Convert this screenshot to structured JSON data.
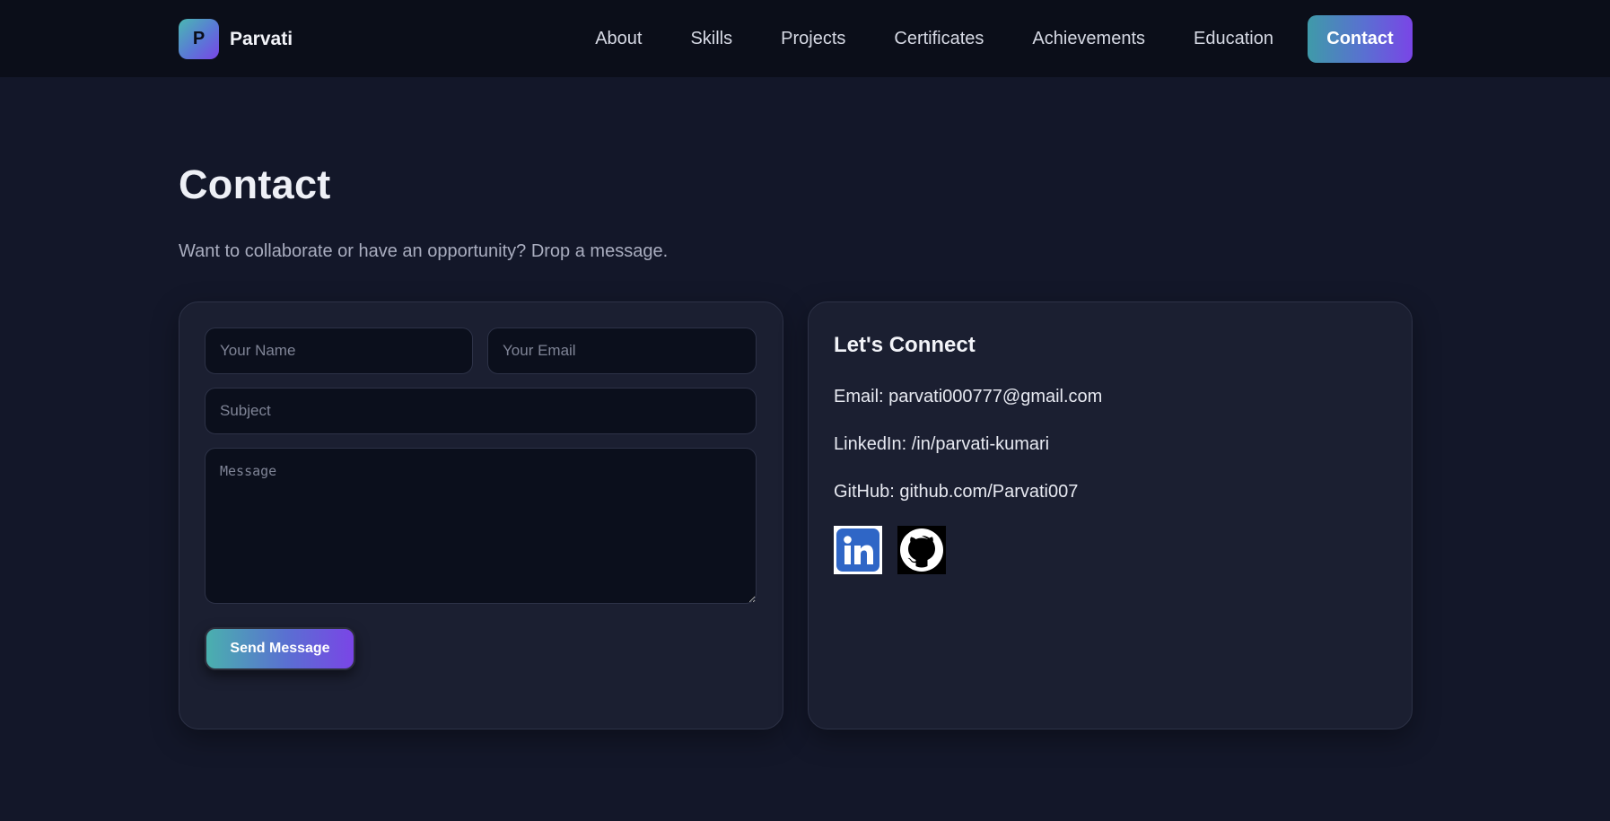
{
  "header": {
    "logo_letter": "P",
    "brand_name": "Parvati",
    "nav": [
      {
        "label": "About"
      },
      {
        "label": "Skills"
      },
      {
        "label": "Projects"
      },
      {
        "label": "Certificates"
      },
      {
        "label": "Achievements"
      },
      {
        "label": "Education"
      }
    ],
    "contact_label": "Contact"
  },
  "page": {
    "title": "Contact",
    "subtitle": "Want to collaborate or have an opportunity? Drop a message."
  },
  "form": {
    "name_placeholder": "Your Name",
    "email_placeholder": "Your Email",
    "subject_placeholder": "Subject",
    "message_placeholder": "Message",
    "send_label": "Send Message"
  },
  "connect": {
    "title": "Let's Connect",
    "email_line": "Email: parvati000777@gmail.com",
    "linkedin_line": "LinkedIn: /in/parvati-kumari",
    "github_line": "GitHub: github.com/Parvati007",
    "icons": [
      "linkedin-icon",
      "github-icon"
    ]
  },
  "colors": {
    "background": "#131729",
    "header_bg": "#0b0e19",
    "card_bg": "#1b1f31",
    "accent_start": "#4ab8b2",
    "accent_end": "#7a45e6",
    "linkedin_blue": "#2f66c6"
  }
}
